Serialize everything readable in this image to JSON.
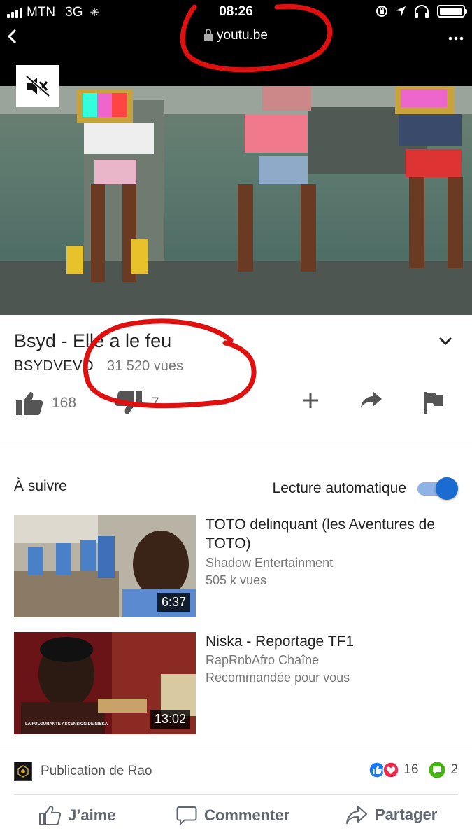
{
  "status_bar": {
    "carrier": "MTN",
    "network": "3G",
    "time": "08:26"
  },
  "url_bar": {
    "url": "youtu.be",
    "load_progress": 0.9
  },
  "video": {
    "title": "Bsyd - Elle a le feu",
    "channel": "BSYDVEVO",
    "views": "31 520 vues",
    "likes": "168",
    "dislikes": "7"
  },
  "up_next": {
    "label": "À suivre",
    "autoplay_label": "Lecture automatique",
    "autoplay_on": true,
    "items": [
      {
        "title": "TOTO delinquant (les Aventures de TOTO)",
        "channel": "Shadow Entertainment",
        "meta": "505 k vues",
        "duration": "6:37"
      },
      {
        "title": "Niska - Reportage TF1",
        "channel": "RapRnbAfro Chaîne",
        "meta": "Recommandée pour vous",
        "duration": "13:02",
        "thumb_caption": "LA FULGURANTE ASCENSION DE NISKA"
      }
    ]
  },
  "facebook": {
    "publication": "Publication de Rao",
    "reactions_count": "16",
    "comments_count": "2",
    "like_label": "J’aime",
    "comment_label": "Commenter",
    "share_label": "Partager"
  },
  "colors": {
    "annotation": "#e01010",
    "fb_blue": "#1877f2",
    "fb_red": "#f0284a",
    "fb_green": "#44b70f",
    "toggle_on": "#1a6bd2"
  }
}
